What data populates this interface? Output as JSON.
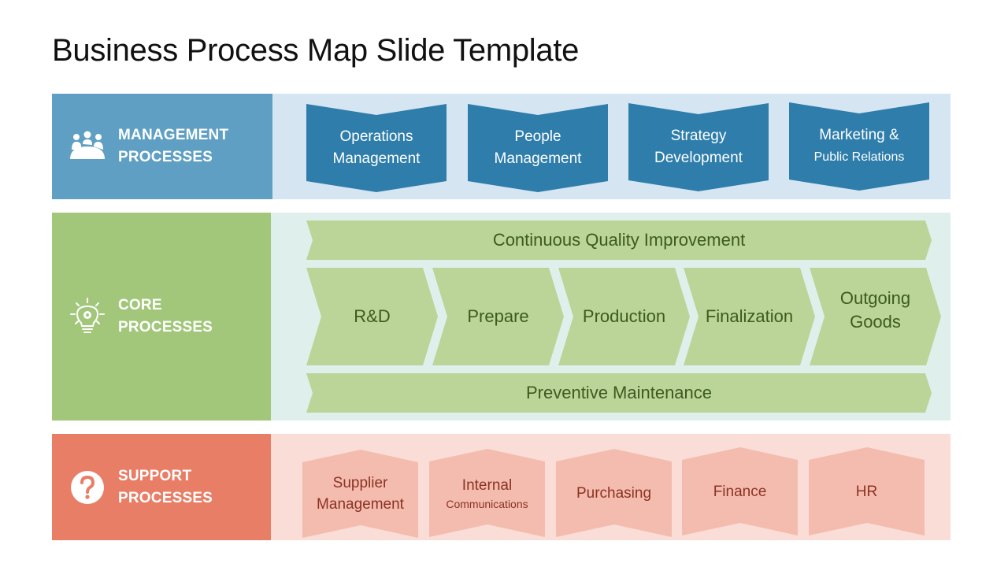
{
  "title": "Business Process Map Slide Template",
  "colors": {
    "management_label": "#5e9fc3",
    "management_bg": "#d5e6f2",
    "management_shape": "#2e7dab",
    "core_label": "#a2c77a",
    "core_bg": "#dff0ec",
    "core_shape": "#bad597",
    "core_text": "#3d5a1f",
    "support_label": "#e97e66",
    "support_bg": "#f9ddd6",
    "support_shape": "#f4bcae",
    "support_text": "#8a3324"
  },
  "management": {
    "icon": "meeting-people-icon",
    "label_line1": "MANAGEMENT",
    "label_line2": "PROCESSES",
    "items": [
      {
        "line1": "Operations",
        "line2": "Management"
      },
      {
        "line1": "People",
        "line2": "Management"
      },
      {
        "line1": "Strategy",
        "line2": "Development"
      },
      {
        "line1": "Marketing  &",
        "line2": "Public Relations"
      }
    ]
  },
  "core": {
    "icon": "lightbulb-gear-icon",
    "label_line1": "CORE",
    "label_line2": "PROCESSES",
    "top_banner": "Continuous Quality Improvement",
    "steps": [
      {
        "line1": "R&D",
        "line2": ""
      },
      {
        "line1": "Prepare",
        "line2": ""
      },
      {
        "line1": "Production",
        "line2": ""
      },
      {
        "line1": "Finalization",
        "line2": ""
      },
      {
        "line1": "Outgoing",
        "line2": "Goods"
      }
    ],
    "bottom_banner": "Preventive Maintenance"
  },
  "support": {
    "icon": "question-circle-icon",
    "label_line1": "SUPPORT",
    "label_line2": "PROCESSES",
    "items": [
      {
        "line1": "Supplier",
        "line2": "Management"
      },
      {
        "line1": "Internal",
        "line2": "Communications"
      },
      {
        "line1": "Purchasing",
        "line2": ""
      },
      {
        "line1": "Finance",
        "line2": ""
      },
      {
        "line1": "HR",
        "line2": ""
      }
    ]
  }
}
